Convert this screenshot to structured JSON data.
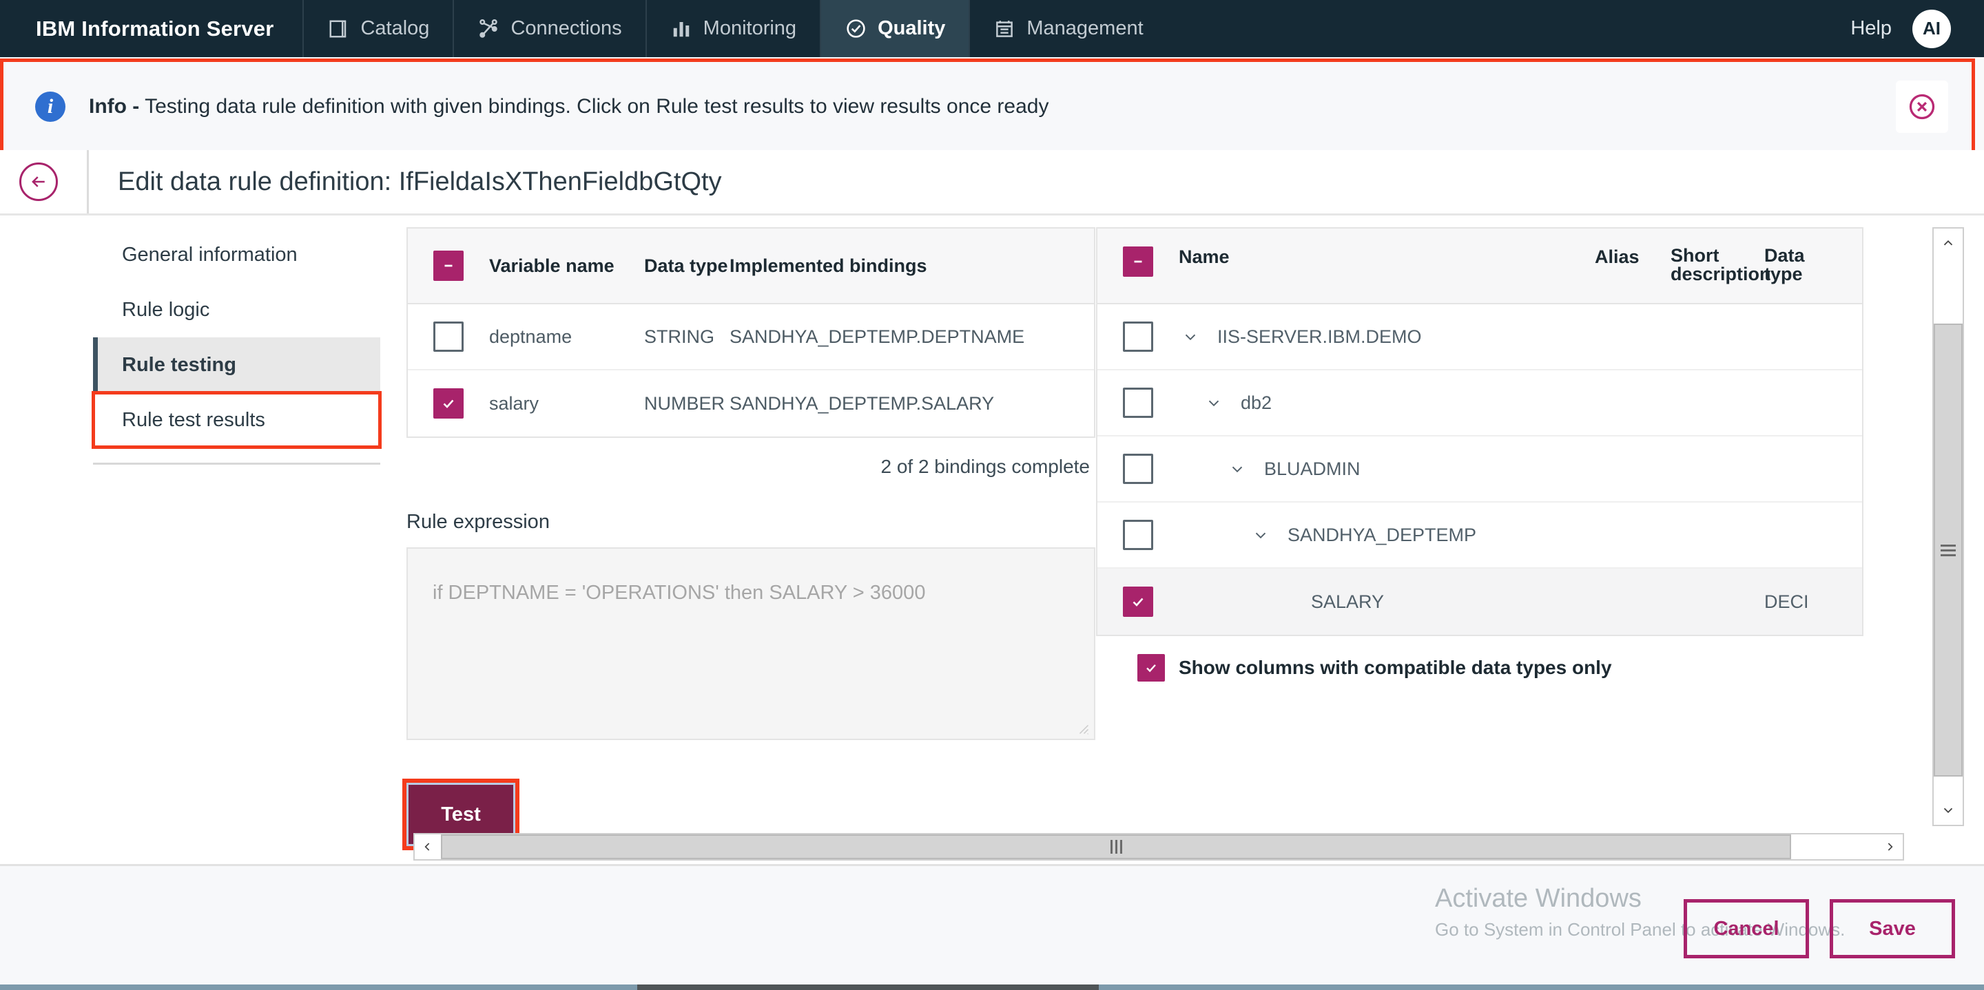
{
  "topnav": {
    "brand": "IBM Information Server",
    "items": [
      {
        "label": "Catalog",
        "icon": "book-icon",
        "active": false
      },
      {
        "label": "Connections",
        "icon": "connections-icon",
        "active": false
      },
      {
        "label": "Monitoring",
        "icon": "bar-chart-icon",
        "active": false
      },
      {
        "label": "Quality",
        "icon": "check-circle-icon",
        "active": true
      },
      {
        "label": "Management",
        "icon": "clipboard-icon",
        "active": false
      }
    ],
    "help_label": "Help",
    "avatar_initials": "AI"
  },
  "banner": {
    "icon": "info-icon",
    "prefix": "Info -",
    "message": "Testing data rule definition with given bindings. Click on Rule test results to view results once ready",
    "close_icon": "close-circle-icon",
    "highlight_color": "#f43b1c"
  },
  "title": {
    "back_icon": "back-arrow-icon",
    "text": "Edit data rule definition: IfFieldaIsXThenFieldbGtQty"
  },
  "sidebar": {
    "items": [
      {
        "label": "General information"
      },
      {
        "label": "Rule logic"
      },
      {
        "label": "Rule testing"
      },
      {
        "label": "Rule test results"
      }
    ]
  },
  "bindings": {
    "headers": {
      "variable_name": "Variable name",
      "data_type": "Data type",
      "implemented_bindings": "Implemented bindings"
    },
    "rows": [
      {
        "checked": false,
        "variable_name": "deptname",
        "data_type": "STRING",
        "binding": "SANDHYA_DEPTEMP.DEPTNAME"
      },
      {
        "checked": true,
        "variable_name": "salary",
        "data_type": "NUMBER",
        "binding": "SANDHYA_DEPTEMP.SALARY"
      }
    ],
    "status": "2 of 2 bindings complete"
  },
  "rule_expression": {
    "label": "Rule expression",
    "value": "if DEPTNAME = 'OPERATIONS' then SALARY > 36000"
  },
  "test_button": {
    "label": "Test"
  },
  "tree": {
    "headers": {
      "name": "Name",
      "alias": "Alias",
      "short_description": "Short description",
      "data_type": "Data type"
    },
    "rows": [
      {
        "checked": false,
        "indent": 0,
        "expandable": true,
        "name": "IIS-SERVER.IBM.DEMO",
        "alias": "",
        "short_description": "",
        "data_type": "",
        "selected": false
      },
      {
        "checked": false,
        "indent": 1,
        "expandable": true,
        "name": "db2",
        "alias": "",
        "short_description": "",
        "data_type": "",
        "selected": false
      },
      {
        "checked": false,
        "indent": 2,
        "expandable": true,
        "name": "BLUADMIN",
        "alias": "",
        "short_description": "",
        "data_type": "",
        "selected": false
      },
      {
        "checked": false,
        "indent": 3,
        "expandable": true,
        "name": "SANDHYA_DEPTEMP",
        "alias": "",
        "short_description": "",
        "data_type": "",
        "selected": false
      },
      {
        "checked": true,
        "indent": 4,
        "expandable": false,
        "name": "SALARY",
        "alias": "",
        "short_description": "",
        "data_type": "DECI",
        "selected": true
      }
    ],
    "compatible_label": "Show columns with compatible data types only",
    "compatible_checked": true
  },
  "footer": {
    "watermark_title": "Activate Windows",
    "watermark_sub": "Go to System in Control Panel to activate Windows.",
    "cancel_label": "Cancel",
    "save_label": "Save"
  },
  "colors": {
    "nav_bg": "#152935",
    "nav_active_bg": "#2d4552",
    "accent_magenta": "#a8236b",
    "test_button_bg": "#7a2048",
    "highlight_red": "#f43b1c",
    "info_blue": "#2f6fd0"
  }
}
